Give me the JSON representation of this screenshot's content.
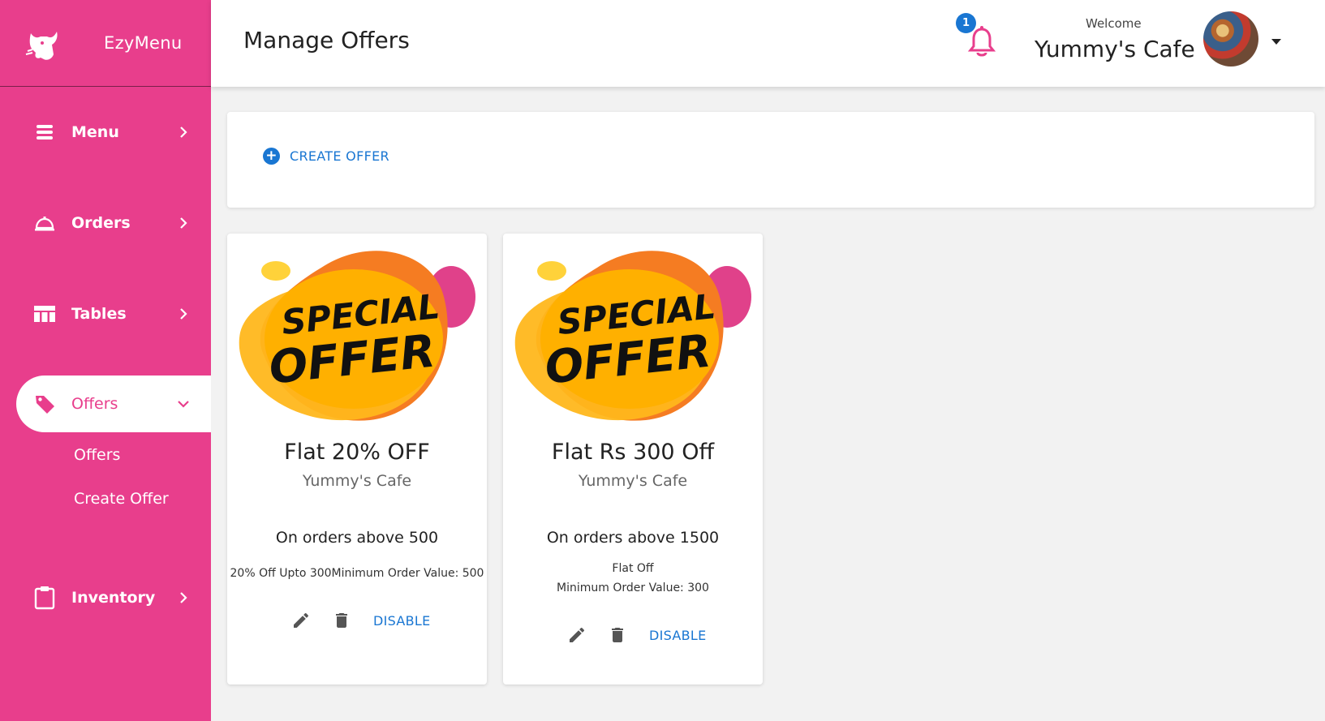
{
  "brand": {
    "name": "EzyMenu"
  },
  "header": {
    "title": "Manage Offers",
    "notification_count": "1",
    "welcome": "Welcome",
    "user_name": "Yummy's Cafe"
  },
  "sidebar": {
    "items": [
      {
        "label": "Menu",
        "icon": "menu-list-icon"
      },
      {
        "label": "Orders",
        "icon": "room-service-icon"
      },
      {
        "label": "Tables",
        "icon": "table-icon"
      },
      {
        "label": "Offers",
        "icon": "tag-icon",
        "active": true
      },
      {
        "label": "Inventory",
        "icon": "clipboard-icon"
      }
    ],
    "offers_sub": [
      "Offers",
      "Create Offer"
    ]
  },
  "create": {
    "label": "CREATE OFFER"
  },
  "offers": [
    {
      "banner_line1": "SPECIAL",
      "banner_line2": "OFFER",
      "title": "Flat 20% OFF",
      "cafe": "Yummy's Cafe",
      "condition": "On orders above 500",
      "detail1": "20% Off Upto 300Minimum Order Value: 500",
      "disable_label": "DISABLE"
    },
    {
      "banner_line1": "SPECIAL",
      "banner_line2": "OFFER",
      "title": "Flat Rs 300 Off",
      "cafe": "Yummy's Cafe",
      "condition": "On orders above 1500",
      "detail1": "Flat Off",
      "detail2": "Minimum Order Value: 300",
      "disable_label": "DISABLE"
    }
  ],
  "colors": {
    "primary": "#e83e8c",
    "accent_blue": "#1976d2"
  }
}
